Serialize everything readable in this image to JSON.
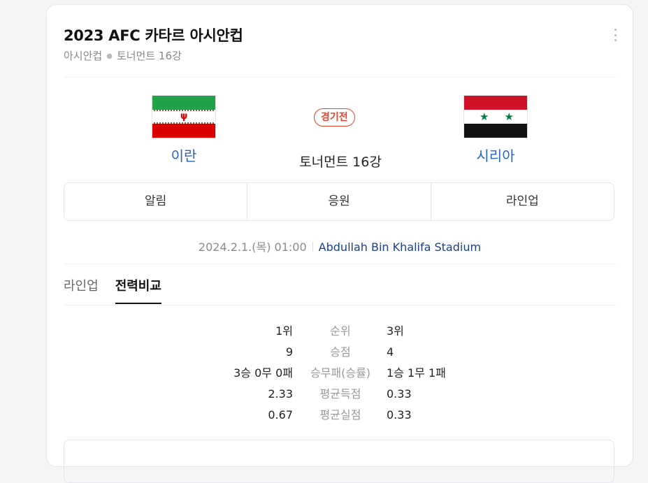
{
  "header": {
    "title": "2023 AFC 카타르 아시안컵",
    "league": "아시안컵",
    "round": "토너먼트 16강"
  },
  "match": {
    "home": {
      "name": "이란",
      "flag": "iran-flag"
    },
    "away": {
      "name": "시리아",
      "flag": "syria-flag"
    },
    "status": "경기전",
    "stage": "토너먼트 16강",
    "datetime": "2024.2.1.(목) 01:00",
    "venue": "Abdullah Bin Khalifa Stadium"
  },
  "actions": {
    "alert": "알림",
    "cheer": "응원",
    "lineup": "라인업"
  },
  "tabs": [
    {
      "label": "라인업",
      "active": false
    },
    {
      "label": "전력비교",
      "active": true
    }
  ],
  "comparison": [
    {
      "home": "1위",
      "label": "순위",
      "away": "3위"
    },
    {
      "home": "9",
      "label": "승점",
      "away": "4"
    },
    {
      "home": "3승 0무 0패",
      "label": "승무패(승률)",
      "away": "1승 1무 1패"
    },
    {
      "home": "2.33",
      "label": "평균득점",
      "away": "0.33"
    },
    {
      "home": "0.67",
      "label": "평균실점",
      "away": "0.33"
    }
  ],
  "colors": {
    "link": "#2765c4",
    "status": "#e0452b",
    "venue": "#1a3f8a"
  }
}
